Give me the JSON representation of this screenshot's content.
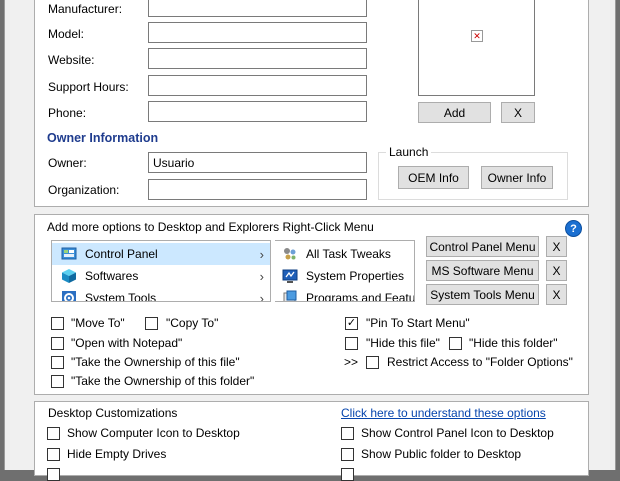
{
  "manufacturer_info": {
    "fields": [
      {
        "label": "Manufacturer:",
        "value": ""
      },
      {
        "label": "Model:",
        "value": ""
      },
      {
        "label": "Website:",
        "value": ""
      },
      {
        "label": "Support Hours:",
        "value": ""
      },
      {
        "label": "Phone:",
        "value": ""
      }
    ],
    "logo_add_label": "Add",
    "logo_remove_label": "X"
  },
  "owner_info": {
    "title": "Owner Information",
    "owner_label": "Owner:",
    "owner_value": "Usuario",
    "organization_label": "Organization:",
    "organization_value": ""
  },
  "launch": {
    "title": "Launch",
    "oem_info_label": "OEM Info",
    "owner_info_label": "Owner Info"
  },
  "context_menu": {
    "title": "Add more options to Desktop and Explorers Right-Click Menu",
    "help_glyph": "?",
    "left_list": [
      "Control Panel",
      "Softwares",
      "System Tools"
    ],
    "right_list": [
      "All Task Tweaks",
      "System Properties",
      "Programs and Featu"
    ],
    "menu_buttons": [
      "Control Panel Menu",
      "MS Software Menu",
      "System Tools Menu"
    ],
    "remove_label": "X",
    "options_left": [
      {
        "label": "\"Move To\"",
        "checked": false
      },
      {
        "label": "\"Open with Notepad\"",
        "checked": false
      },
      {
        "label": "\"Take the Ownership of this file\"",
        "checked": false
      },
      {
        "label": "\"Take the Ownership of this folder\"",
        "checked": false
      }
    ],
    "copy_to": {
      "label": "\"Copy To\"",
      "checked": false
    },
    "pin_to_start": {
      "label": "\"Pin To Start Menu\"",
      "checked": true
    },
    "hide_file": {
      "label": "\"Hide this file\"",
      "checked": false
    },
    "hide_folder": {
      "label": "\"Hide this folder\"",
      "checked": false
    },
    "restrict_prefix": ">>",
    "restrict_access": {
      "label": "Restrict Access to \"Folder Options\"",
      "checked": false
    }
  },
  "desktop": {
    "title": "Desktop Customizations",
    "help_link": "Click here to understand these options",
    "left": [
      {
        "label": "Show Computer Icon to Desktop",
        "checked": false
      },
      {
        "label": "Hide Empty Drives",
        "checked": false
      }
    ],
    "right": [
      {
        "label": "Show Control Panel Icon to Desktop",
        "checked": false
      },
      {
        "label": "Show Public folder to Desktop",
        "checked": false
      }
    ]
  },
  "colors": {
    "section_title": "#1f3c8e",
    "selected_row": "#cce8ff",
    "help_icon": "#1a6fd1",
    "link": "#0645ad"
  },
  "icons": {
    "broken_image": "broken-image-icon",
    "help": "help-icon",
    "control_panel": "control-panel-icon",
    "softwares": "software-cube-icon",
    "system_tools": "system-tools-gear-icon",
    "task_tweaks": "all-task-tweaks-icon",
    "system_properties": "system-properties-icon",
    "programs": "programs-and-features-icon",
    "expand_arrow": "chevron-right-icon"
  }
}
